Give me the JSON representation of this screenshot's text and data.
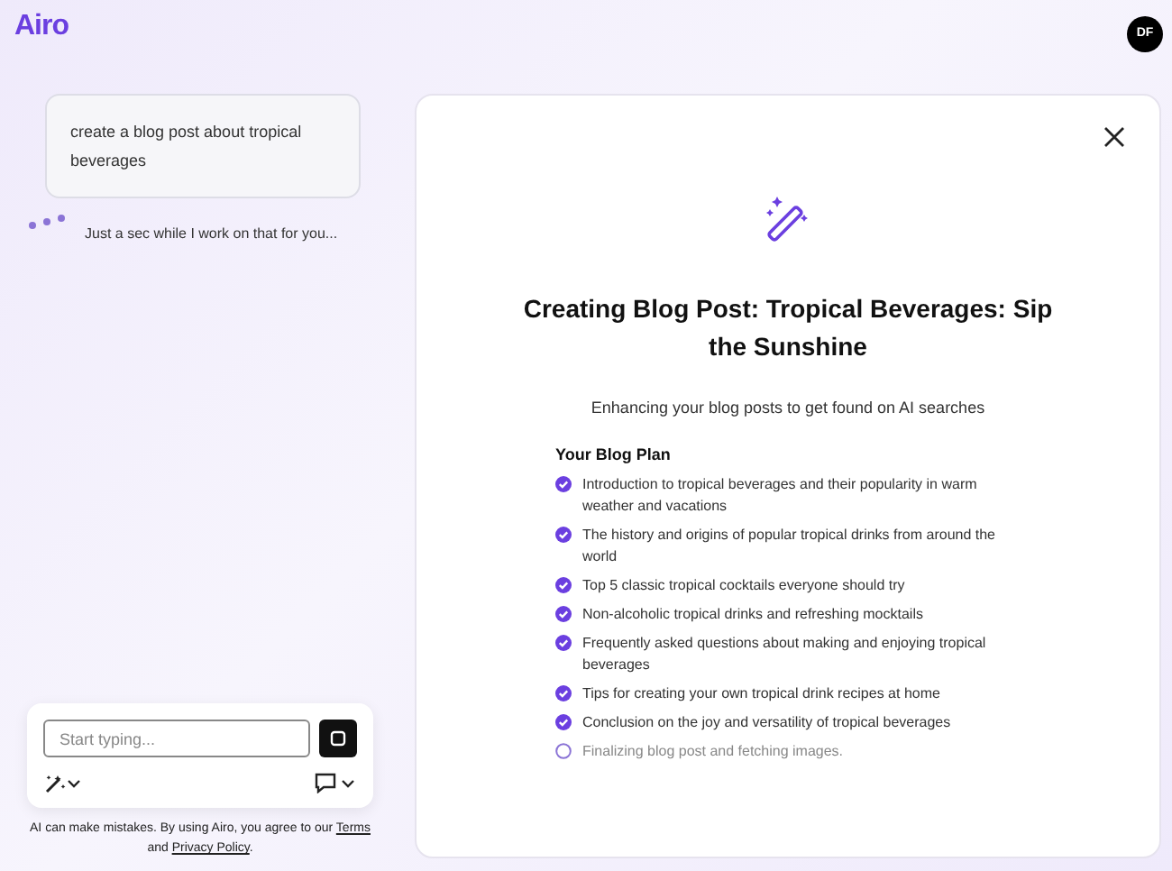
{
  "header": {
    "logo": "Airo",
    "avatar": "DF"
  },
  "chat": {
    "user_message": "create a blog post about tropical beverages",
    "status": "Just a sec while I work on that for you..."
  },
  "composer": {
    "placeholder": "Start typing...",
    "disclaimer": "AI can make mistakes. By using Airo, you agree to our ",
    "terms_link": "Terms",
    "and": "and ",
    "privacy_link": "Privacy Policy",
    "end": "."
  },
  "panel": {
    "title": "Creating Blog Post: Tropical Beverages: Sip the Sunshine",
    "subtitle": "Enhancing your blog posts to get found on AI searches",
    "plan_heading": "Your Blog Plan",
    "plan": [
      {
        "text": "Introduction to tropical beverages and their popularity in warm weather and vacations",
        "checked": true
      },
      {
        "text": "The history and origins of popular tropical drinks from around the world",
        "checked": true
      },
      {
        "text": "Top 5 classic tropical cocktails everyone should try",
        "checked": true
      },
      {
        "text": "Non-alcoholic tropical drinks and refreshing mocktails",
        "checked": true
      },
      {
        "text": "Frequently asked questions about making and enjoying tropical beverages",
        "checked": true
      },
      {
        "text": "Tips for creating your own tropical drink recipes at home",
        "checked": true
      },
      {
        "text": "Conclusion on the joy and versatility of tropical beverages",
        "checked": true
      },
      {
        "text": "Finalizing blog post and fetching images.",
        "checked": false
      }
    ]
  }
}
